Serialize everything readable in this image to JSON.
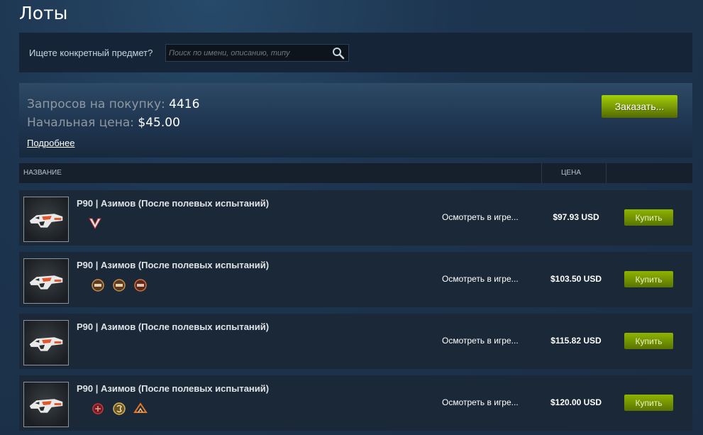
{
  "page": {
    "title": "Лоты"
  },
  "search": {
    "label": "Ищете конкретный предмет?",
    "placeholder": "Поиск по имени, описанию, типу",
    "value": ""
  },
  "orders": {
    "requests_label": "Запросов на покупку:",
    "requests_value": "4416",
    "start_price_label": "Начальная цена:",
    "start_price_value": "$45.00",
    "more_link": "Подробнее",
    "order_button": "Заказать..."
  },
  "table": {
    "headers": {
      "name": "НАЗВАНИЕ",
      "price": "ЦЕНА"
    }
  },
  "colors": {
    "accent_green": "#a4d007",
    "background": "#1b2838",
    "row": "#1a2838"
  },
  "listings": [
    {
      "name": "P90 | Азимов (После полевых испытаний)",
      "inspect": "Осмотреть в игре...",
      "price": "$97.93 USD",
      "buy": "Купить",
      "stickers": [
        "virtus-pro-sticker-icon"
      ]
    },
    {
      "name": "P90 | Азимов (После полевых испытаний)",
      "inspect": "Осмотреть в игре...",
      "price": "$103.50 USD",
      "buy": "Купить",
      "stickers": [
        "team-sticker-icon",
        "team-sticker-icon",
        "team-sticker-icon"
      ]
    },
    {
      "name": "P90 | Азимов (После полевых испытаний)",
      "inspect": "Осмотреть в игре...",
      "price": "$115.82 USD",
      "buy": "Купить",
      "stickers": []
    },
    {
      "name": "P90 | Азимов (После полевых испытаний)",
      "inspect": "Осмотреть в игре...",
      "price": "$120.00 USD",
      "buy": "Купить",
      "stickers": [
        "red-team-sticker-icon",
        "gold-team-sticker-icon",
        "orange-team-sticker-icon"
      ]
    }
  ]
}
